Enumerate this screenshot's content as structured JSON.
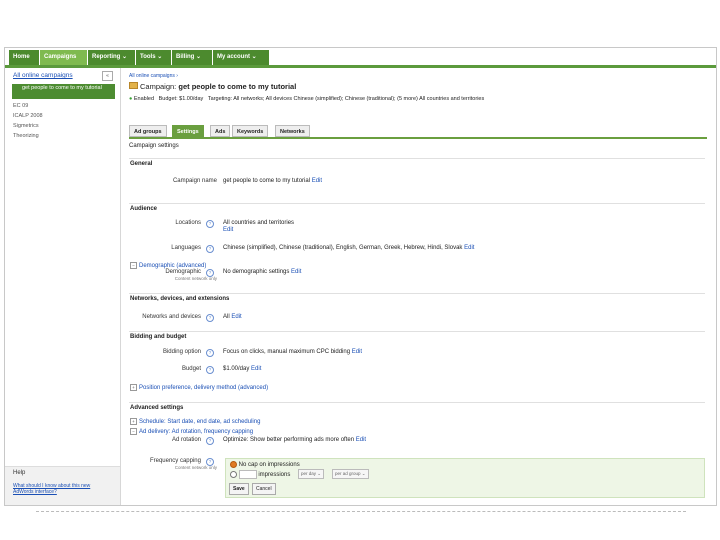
{
  "topnav": {
    "tabs": [
      {
        "label": "Home",
        "active": false
      },
      {
        "label": "Campaigns",
        "active": true
      },
      {
        "label": "Reporting ⌄",
        "active": false
      },
      {
        "label": "Tools ⌄",
        "active": false
      },
      {
        "label": "Billing ⌄",
        "active": false
      },
      {
        "label": "My account ⌄",
        "active": false
      }
    ]
  },
  "sidebar": {
    "title": "All online campaigns",
    "collapse": "«",
    "active_item": "get people to come to my tutorial",
    "items": [
      "EC 09",
      "ICALP 2008",
      "Sigmetrics",
      "Theorizing"
    ],
    "help_title": "Help",
    "help_link": "What should I know about this new AdWords interface?"
  },
  "main": {
    "breadcrumb": "All online campaigns ›",
    "campaign_prefix": "Campaign:",
    "campaign_name": "get people to come to my tutorial",
    "status_dot": "●",
    "status": "Enabled",
    "budget": "Budget: $1.00/day",
    "targeting": "Targeting: All networks; All devices    Chinese (simplified); Chinese (traditional); (5 more)    All countries and territories",
    "tabs": [
      {
        "label": "Ad groups",
        "active": false
      },
      {
        "label": "Settings",
        "active": true
      },
      {
        "label": "Ads",
        "active": false
      },
      {
        "label": "Keywords",
        "active": false
      },
      {
        "label": "Networks",
        "active": false
      }
    ],
    "panel_title": "Campaign settings",
    "sections": {
      "general": "General",
      "audience": "Audience",
      "networks": "Networks, devices, and extensions",
      "bidding": "Bidding and budget",
      "advanced": "Advanced settings"
    },
    "rows": {
      "campaign_name_label": "Campaign name",
      "campaign_name_value": "get people to come to my tutorial",
      "locations_label": "Locations",
      "locations_value": "All countries and territories",
      "languages_label": "Languages",
      "languages_value": "Chinese (simplified), Chinese (traditional), English, German, Greek, Hebrew, Hindi, Slovak",
      "demographic_toggle": "Demographic (advanced)",
      "demographic_label": "Demographic",
      "demographic_sub": "Content network only",
      "demographic_value": "No demographic settings",
      "networks_label": "Networks and devices",
      "networks_value": "All",
      "bidding_label": "Bidding option",
      "bidding_value": "Focus on clicks, manual maximum CPC bidding",
      "budget_label": "Budget",
      "budget_value": "$1.00/day",
      "position_pref": "Position preference, delivery method (advanced)",
      "schedule": "Schedule: Start date, end date, ad scheduling",
      "ad_delivery": "Ad delivery: Ad rotation, frequency capping",
      "ad_rotation_label": "Ad rotation",
      "ad_rotation_value": "Optimize: Show better performing ads more often",
      "freq_label": "Frequency capping",
      "freq_sub": "Content network only",
      "freq_opt1": "No cap on impressions",
      "freq_opt2": "impressions",
      "freq_per": "per day",
      "freq_scope": "per ad group",
      "edit": "Edit",
      "save": "Save",
      "cancel": "Cancel"
    }
  }
}
